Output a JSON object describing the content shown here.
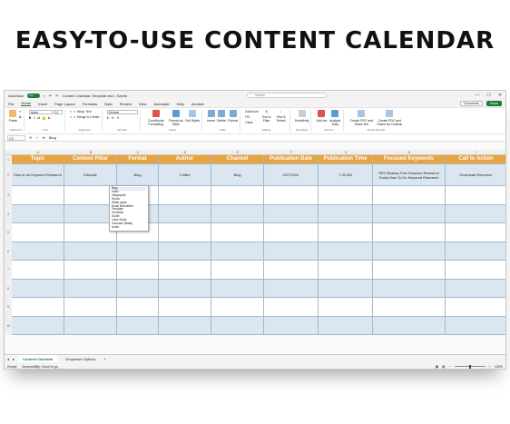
{
  "hero_title": "EASY-TO-USE CONTENT CALENDAR",
  "colors": {
    "accent": "#1a7f37",
    "header_bg": "#e8a33d",
    "row_band": "#dbe6f1",
    "row_plain": "#ffffff",
    "highlight": "#d7e5f3"
  },
  "window": {
    "autosave": "AutoSave",
    "autosave_state": "On",
    "file_title": "Content Calendar Template.xlsx • Saved",
    "search_placeholder": "Search",
    "controls": [
      "—",
      "☐",
      "✕"
    ]
  },
  "menu": {
    "items": [
      "File",
      "Home",
      "Insert",
      "Page Layout",
      "Formulas",
      "Data",
      "Review",
      "View",
      "Automate",
      "Help",
      "Acrobat"
    ],
    "active": "Home",
    "comments": "Comments",
    "share": "Share"
  },
  "ribbon": {
    "paste": "Paste",
    "font": "Aptos",
    "font_size": "11",
    "wrap": "Wrap Text",
    "merge": "Merge & Center",
    "number_format": "General",
    "conditional": "Conditional Formatting",
    "format_table": "Format as Table",
    "cell_styles": "Cell Styles",
    "insert": "Insert",
    "delete": "Delete",
    "format": "Format",
    "autosum": "AutoSum",
    "fill": "Fill",
    "clear": "Clear",
    "sort": "Sort & Filter",
    "find": "Find & Select",
    "sensitivity": "Sensitivity",
    "addins": "Add-ins",
    "analyze": "Analyze Data",
    "pdf1": "Create PDF and Share link",
    "pdf2": "Create PDF and Share via Outlook",
    "groups": [
      "Clipboard",
      "Font",
      "Alignment",
      "Number",
      "Styles",
      "Cells",
      "Editing",
      "Sensitivity",
      "Add-ins",
      "Adobe Acrobat"
    ]
  },
  "formula_bar": {
    "name_box": "C2",
    "fx": "fx",
    "value": "Blog"
  },
  "columns": [
    "A",
    "B",
    "C",
    "D",
    "E",
    "F",
    "G",
    "H",
    "I"
  ],
  "headers": [
    "Topic",
    "Content Pillar",
    "Format",
    "Author",
    "Channel",
    "Publication Date",
    "Publication Time",
    "Focused Keywords",
    "Call to Action"
  ],
  "rows": [
    [
      "How to do Keyword Research",
      "Educate",
      "Blog",
      "J Miller",
      "Blog",
      "2/27/2024",
      "7:30 AM",
      "SEO Basics| Free Keyword Research Tools| How To Do Keyword Research",
      "Download Resource"
    ]
  ],
  "row_numbers": [
    "1",
    "2",
    "3",
    "4",
    "5",
    "6",
    "7",
    "8",
    "9",
    "10"
  ],
  "dropdown": {
    "options": [
      "Blog",
      "Video",
      "Infographic",
      "Ebook",
      "White paper",
      "Email Newsletter",
      "Template",
      "Checklist",
      "Guide",
      "Case Study",
      "Carousel (static)",
      "Audio"
    ],
    "selected": "Blog"
  },
  "sheet_tabs": [
    "Content Calendar",
    "Dropdown Options"
  ],
  "active_tab": "Content Calendar",
  "status": {
    "ready": "Ready",
    "accessibility": "Accessibility: Good to go",
    "zoom": "100%"
  }
}
